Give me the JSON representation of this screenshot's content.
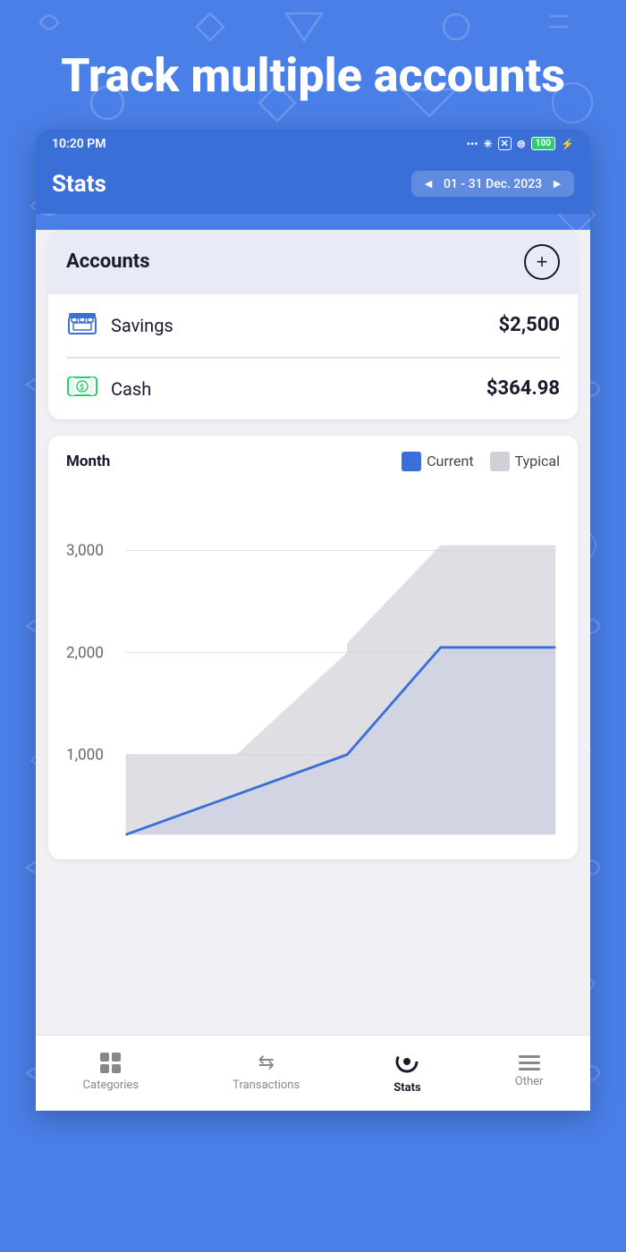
{
  "background": {
    "color": "#4a7fe8"
  },
  "promo": {
    "title": "Track multiple accounts"
  },
  "statusBar": {
    "time": "10:20 PM",
    "battery": "100",
    "icons": "... ✳ ✕ ⊜ ⚡"
  },
  "appHeader": {
    "title": "Stats",
    "leftArrow": "◄",
    "dateRange": "01 - 31 Dec. 2023",
    "rightArrow": "►"
  },
  "accounts": {
    "title": "Accounts",
    "addButtonLabel": "+",
    "items": [
      {
        "name": "Savings",
        "amount": "$2,500",
        "iconType": "bank"
      },
      {
        "name": "Cash",
        "amount": "$364.98",
        "iconType": "cash"
      }
    ]
  },
  "chart": {
    "periodLabel": "Month",
    "currentLabel": "Current",
    "typicalLabel": "Typical",
    "yLabels": [
      "3,000",
      "2,000",
      "1,000"
    ],
    "currentColor": "#3a6fd8",
    "typicalColor": "#d0d0d8"
  },
  "bottomNav": {
    "items": [
      {
        "label": "Categories",
        "icon": "grid",
        "active": false
      },
      {
        "label": "Transactions",
        "icon": "arrows",
        "active": false
      },
      {
        "label": "Stats",
        "icon": "donut",
        "active": true
      },
      {
        "label": "Other",
        "icon": "lines",
        "active": false
      }
    ]
  }
}
